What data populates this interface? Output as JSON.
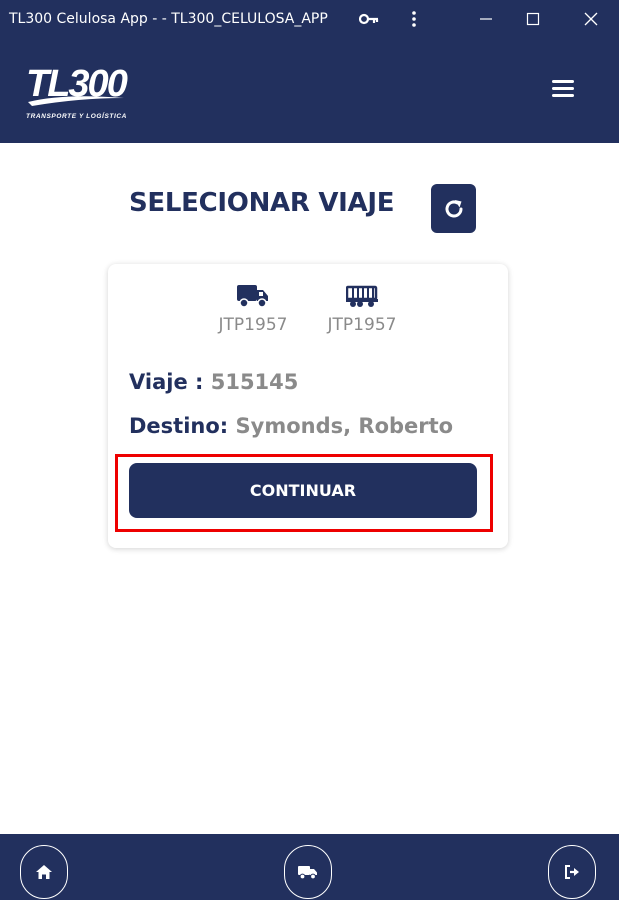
{
  "window": {
    "title": "TL300 Celulosa App - - TL300_CELULOSA_APP",
    "icons": [
      "key-icon",
      "more-vertical-icon",
      "minimize-icon",
      "maximize-icon",
      "close-icon"
    ]
  },
  "header": {
    "logo_text": "TL300",
    "logo_subtitle": "TRANSPORTE Y LOGÍSTICA",
    "menu_icon": "hamburger-menu-icon"
  },
  "page": {
    "title": "SELECIONAR VIAJE",
    "refresh_icon": "refresh-icon"
  },
  "trip_card": {
    "truck": {
      "icon": "truck-icon",
      "plate": "JTP1957"
    },
    "trailer": {
      "icon": "trailer-icon",
      "plate": "JTP1957"
    },
    "trip_label": "Viaje : ",
    "trip_value": "515145",
    "destination_label": "Destino: ",
    "destination_value": "Symonds, Roberto",
    "continue_label": "CONTINUAR"
  },
  "footer": {
    "home_icon": "home-icon",
    "truck_icon": "truck-icon",
    "logout_icon": "logout-icon"
  },
  "colors": {
    "primary": "#22305e",
    "muted_text": "#8a8a8a",
    "highlight": "#ee0000",
    "background": "#ffffff"
  }
}
